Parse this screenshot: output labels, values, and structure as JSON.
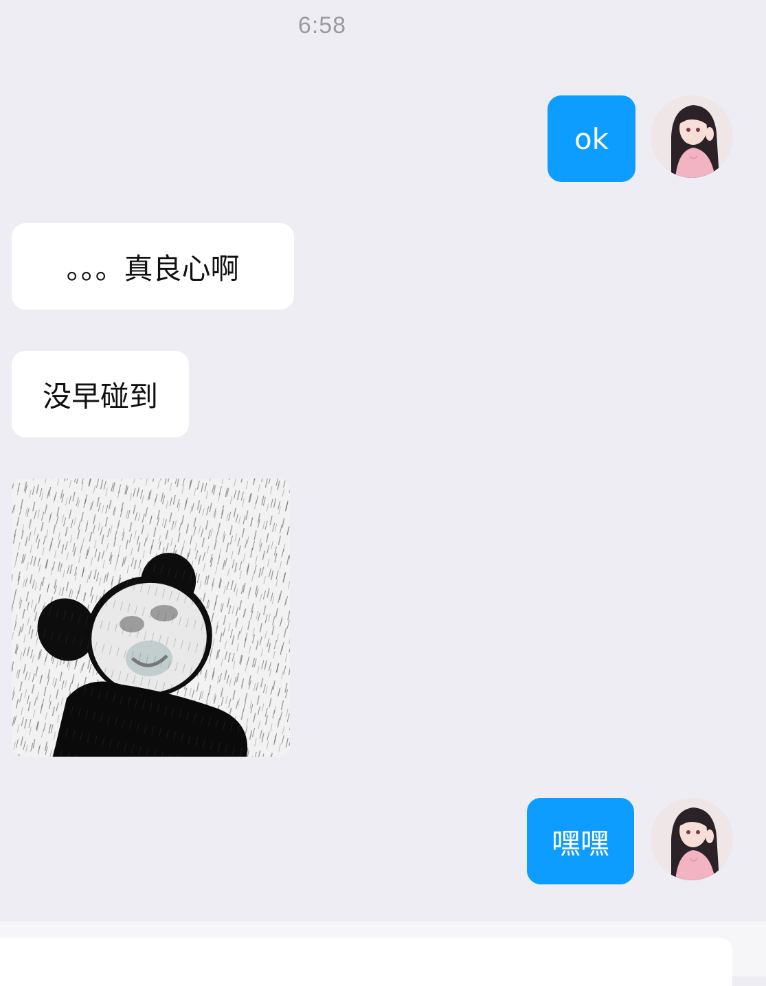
{
  "chat": {
    "timestamp": "6:58",
    "messages": [
      {
        "direction": "outgoing",
        "text": "ok"
      },
      {
        "direction": "incoming",
        "text": "。。。真良心啊"
      },
      {
        "direction": "incoming",
        "text": "没早碰到"
      },
      {
        "direction": "incoming",
        "type": "sticker",
        "sticker": "panda-in-rain"
      },
      {
        "direction": "outgoing",
        "text": "嘿嘿"
      }
    ]
  },
  "icons": {
    "avatar": "avatar-girl-pink-sweater",
    "sticker": "panda-in-rain-sticker"
  },
  "colors": {
    "background": "#ededf3",
    "outgoing_bubble": "#0d9cff",
    "incoming_bubble": "#ffffff",
    "timestamp_text": "#9a9a9f"
  }
}
